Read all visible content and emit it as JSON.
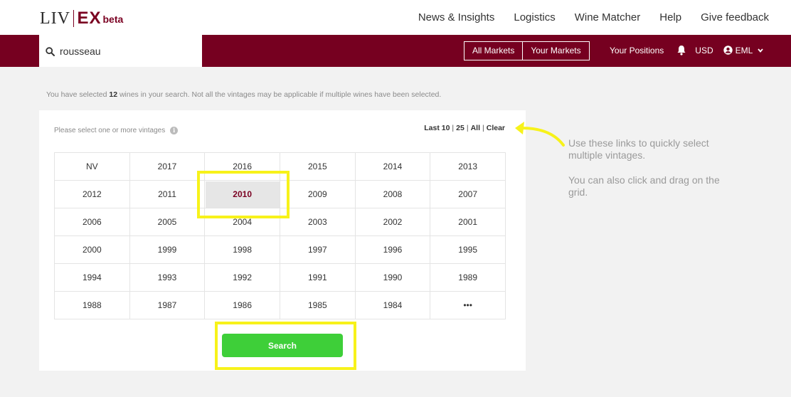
{
  "header": {
    "logo": {
      "liv": "LIV",
      "ex": "EX",
      "beta": "beta"
    },
    "nav": [
      "News & Insights",
      "Logistics",
      "Wine Matcher",
      "Help",
      "Give feedback"
    ]
  },
  "toolbar": {
    "search_value": "rousseau",
    "all_markets": "All Markets",
    "your_markets": "Your Markets",
    "your_positions": "Your Positions",
    "currency": "USD",
    "user": "EML"
  },
  "info": {
    "prefix": "You have selected ",
    "count": "12",
    "suffix": " wines in your search. Not all the vintages may be applicable if multiple wines have been selected."
  },
  "panel": {
    "prompt": "Please select one or more vintages",
    "quick_links": {
      "last10": "Last 10",
      "l25": "25",
      "all": "All",
      "clear": "Clear"
    },
    "selected_vintage": "2010",
    "vintages": [
      "NV",
      "2017",
      "2016",
      "2015",
      "2014",
      "2013",
      "2012",
      "2011",
      "2010",
      "2009",
      "2008",
      "2007",
      "2006",
      "2005",
      "2004",
      "2003",
      "2002",
      "2001",
      "2000",
      "1999",
      "1998",
      "1997",
      "1996",
      "1995",
      "1994",
      "1993",
      "1992",
      "1991",
      "1990",
      "1989",
      "1988",
      "1987",
      "1986",
      "1985",
      "1984",
      "•••"
    ],
    "search_button": "Search"
  },
  "annotations": {
    "note1": "Use these links to quickly select multiple vintages.",
    "note2": "You can also click and drag on the grid.",
    "highlight_color": "#f7f21a"
  },
  "colors": {
    "brand": "#760020",
    "accent": "#3ecf39"
  }
}
